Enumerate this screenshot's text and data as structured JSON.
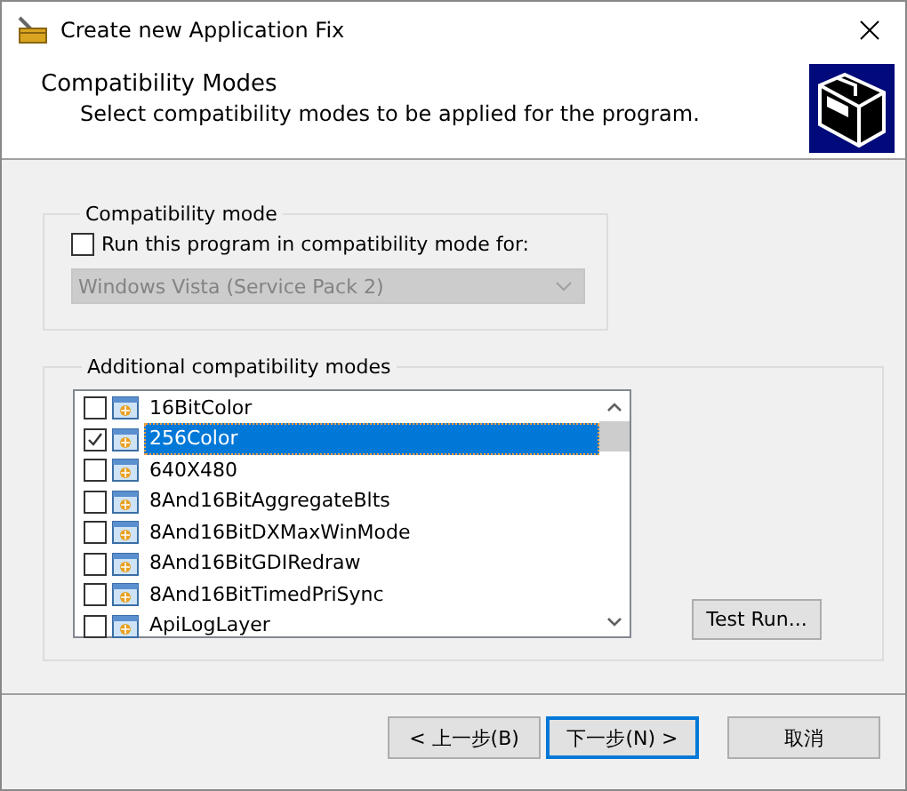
{
  "window": {
    "title": "Create new Application Fix"
  },
  "header": {
    "title": "Compatibility Modes",
    "subtitle": "Select compatibility modes to be applied for the program."
  },
  "compatibility_group": {
    "label": "Compatibility mode",
    "checkbox": {
      "label": "Run this program in compatibility mode for:",
      "checked": false
    },
    "dropdown": {
      "value": "Windows Vista (Service Pack 2)",
      "disabled": true
    }
  },
  "additional_group": {
    "label": "Additional compatibility modes",
    "items": [
      {
        "label": "16BitColor",
        "checked": false,
        "selected": false
      },
      {
        "label": "256Color",
        "checked": true,
        "selected": true
      },
      {
        "label": "640X480",
        "checked": false,
        "selected": false
      },
      {
        "label": "8And16BitAggregateBlts",
        "checked": false,
        "selected": false
      },
      {
        "label": "8And16BitDXMaxWinMode",
        "checked": false,
        "selected": false
      },
      {
        "label": "8And16BitGDIRedraw",
        "checked": false,
        "selected": false
      },
      {
        "label": "8And16BitTimedPriSync",
        "checked": false,
        "selected": false
      },
      {
        "label": "ApiLogLayer",
        "checked": false,
        "selected": false
      }
    ],
    "test_button": "Test Run..."
  },
  "buttons": [
    {
      "label": "< 上一步(B)",
      "kind": "back"
    },
    {
      "label": "下一步(N) >",
      "kind": "next"
    },
    {
      "label": "取消",
      "kind": "cancel"
    }
  ]
}
